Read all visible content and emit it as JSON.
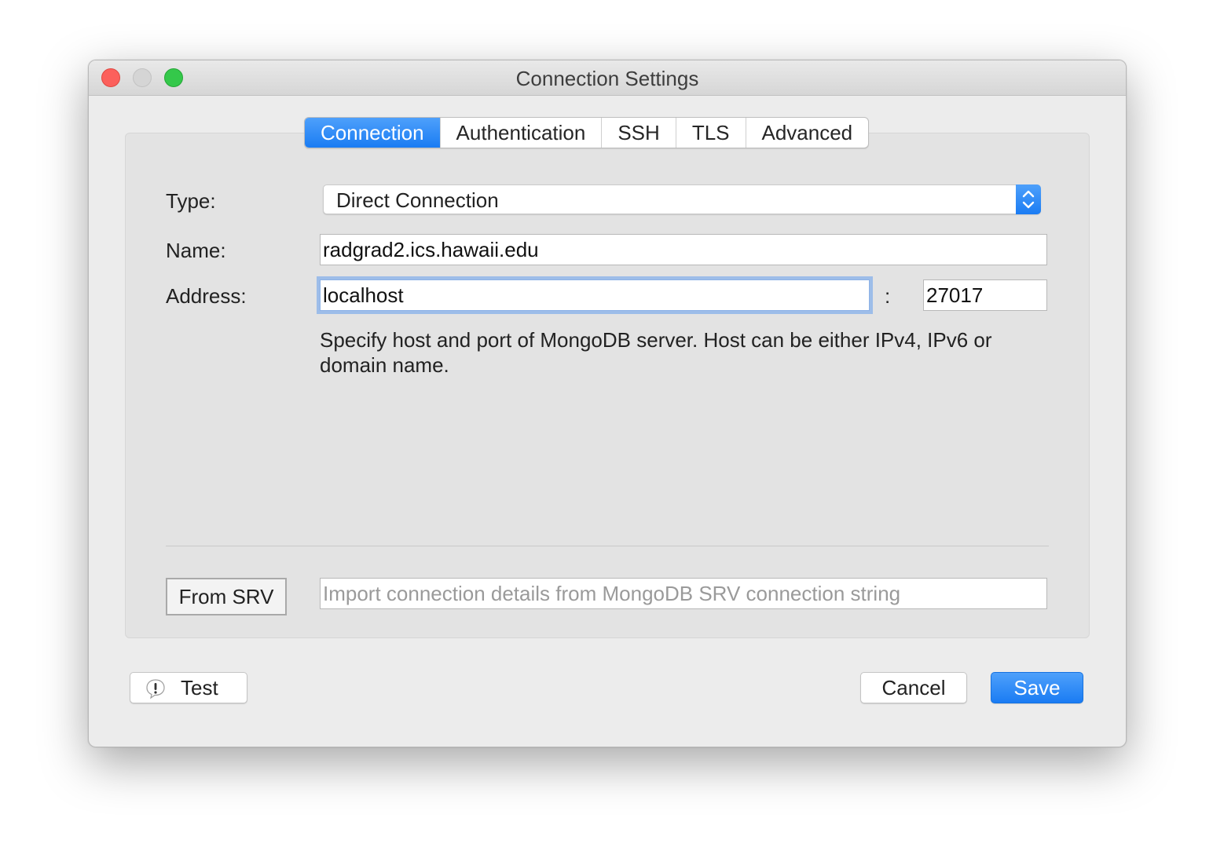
{
  "window": {
    "title": "Connection Settings"
  },
  "tabs": [
    {
      "label": "Connection",
      "active": true
    },
    {
      "label": "Authentication",
      "active": false
    },
    {
      "label": "SSH",
      "active": false
    },
    {
      "label": "TLS",
      "active": false
    },
    {
      "label": "Advanced",
      "active": false
    }
  ],
  "form": {
    "type_label": "Type:",
    "type_value": "Direct Connection",
    "name_label": "Name:",
    "name_value": "radgrad2.ics.hawaii.edu",
    "address_label": "Address:",
    "address_value": "localhost",
    "port_separator": ":",
    "port_value": "27017",
    "hint": "Specify host and port of MongoDB server. Host can be either IPv4, IPv6 or domain name.",
    "srv_button": "From SRV",
    "srv_placeholder": "Import connection details from MongoDB SRV connection string"
  },
  "footer": {
    "test_label": "Test",
    "cancel_label": "Cancel",
    "save_label": "Save"
  },
  "colors": {
    "accent": "#1a7cf3",
    "traffic_close": "#fc605c",
    "traffic_max": "#34c84a"
  },
  "icons": {
    "test": "warning-speech-bubble-icon",
    "select": "updown-chevron-icon"
  }
}
